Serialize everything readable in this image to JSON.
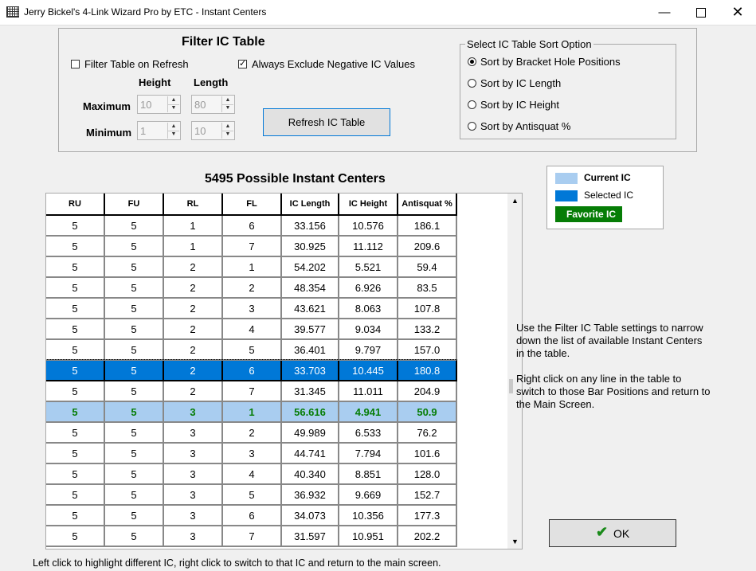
{
  "window": {
    "title": "Jerry Bickel's 4-Link Wizard Pro by ETC - Instant Centers"
  },
  "filter": {
    "heading": "Filter IC Table",
    "filter_on_refresh": {
      "label": "Filter Table on Refresh",
      "checked": false
    },
    "exclude_negative": {
      "label": "Always Exclude Negative IC Values",
      "checked": true
    },
    "col_height": "Height",
    "col_length": "Length",
    "row_max": "Maximum",
    "row_min": "Minimum",
    "max_height": "10",
    "max_length": "80",
    "min_height": "1",
    "min_length": "10",
    "refresh_button": "Refresh IC Table"
  },
  "sort": {
    "legend": "Select IC Table Sort Option",
    "options": [
      {
        "label": "Sort by Bracket Hole Positions",
        "selected": true
      },
      {
        "label": "Sort by IC Length",
        "selected": false
      },
      {
        "label": "Sort by IC Height",
        "selected": false
      },
      {
        "label": "Sort by Antisquat %",
        "selected": false
      }
    ]
  },
  "legend": {
    "current": "Current IC",
    "selected": "Selected IC",
    "favorite": "Favorite IC",
    "current_color": "#a9cdf0",
    "selected_color": "#0078d7",
    "favorite_color": "#067d06"
  },
  "table": {
    "title": "5495 Possible Instant Centers",
    "columns": [
      "RU",
      "FU",
      "RL",
      "FL",
      "IC Length",
      "IC Height",
      "Antisquat %"
    ],
    "rows": [
      [
        "5",
        "5",
        "1",
        "6",
        "33.156",
        "10.576",
        "186.1"
      ],
      [
        "5",
        "5",
        "1",
        "7",
        "30.925",
        "11.112",
        "209.6"
      ],
      [
        "5",
        "5",
        "2",
        "1",
        "54.202",
        "5.521",
        "59.4"
      ],
      [
        "5",
        "5",
        "2",
        "2",
        "48.354",
        "6.926",
        "83.5"
      ],
      [
        "5",
        "5",
        "2",
        "3",
        "43.621",
        "8.063",
        "107.8"
      ],
      [
        "5",
        "5",
        "2",
        "4",
        "39.577",
        "9.034",
        "133.2"
      ],
      [
        "5",
        "5",
        "2",
        "5",
        "36.401",
        "9.797",
        "157.0"
      ],
      [
        "5",
        "5",
        "2",
        "6",
        "33.703",
        "10.445",
        "180.8"
      ],
      [
        "5",
        "5",
        "2",
        "7",
        "31.345",
        "11.011",
        "204.9"
      ],
      [
        "5",
        "5",
        "3",
        "1",
        "56.616",
        "4.941",
        "50.9"
      ],
      [
        "5",
        "5",
        "3",
        "2",
        "49.989",
        "6.533",
        "76.2"
      ],
      [
        "5",
        "5",
        "3",
        "3",
        "44.741",
        "7.794",
        "101.6"
      ],
      [
        "5",
        "5",
        "3",
        "4",
        "40.340",
        "8.851",
        "128.0"
      ],
      [
        "5",
        "5",
        "3",
        "5",
        "36.932",
        "9.669",
        "152.7"
      ],
      [
        "5",
        "5",
        "3",
        "6",
        "34.073",
        "10.356",
        "177.3"
      ],
      [
        "5",
        "5",
        "3",
        "7",
        "31.597",
        "10.951",
        "202.2"
      ]
    ],
    "selected_row": 7,
    "current_row": 9
  },
  "instructions": {
    "p1": "Use the Filter IC Table settings to narrow down the list of available Instant Centers in the table.",
    "p2": "Right click on any line in the table to switch to those Bar Positions and return to the Main Screen."
  },
  "ok_button": "OK",
  "status": "Left click to highlight different IC, right click to switch to that IC and return to the main screen."
}
